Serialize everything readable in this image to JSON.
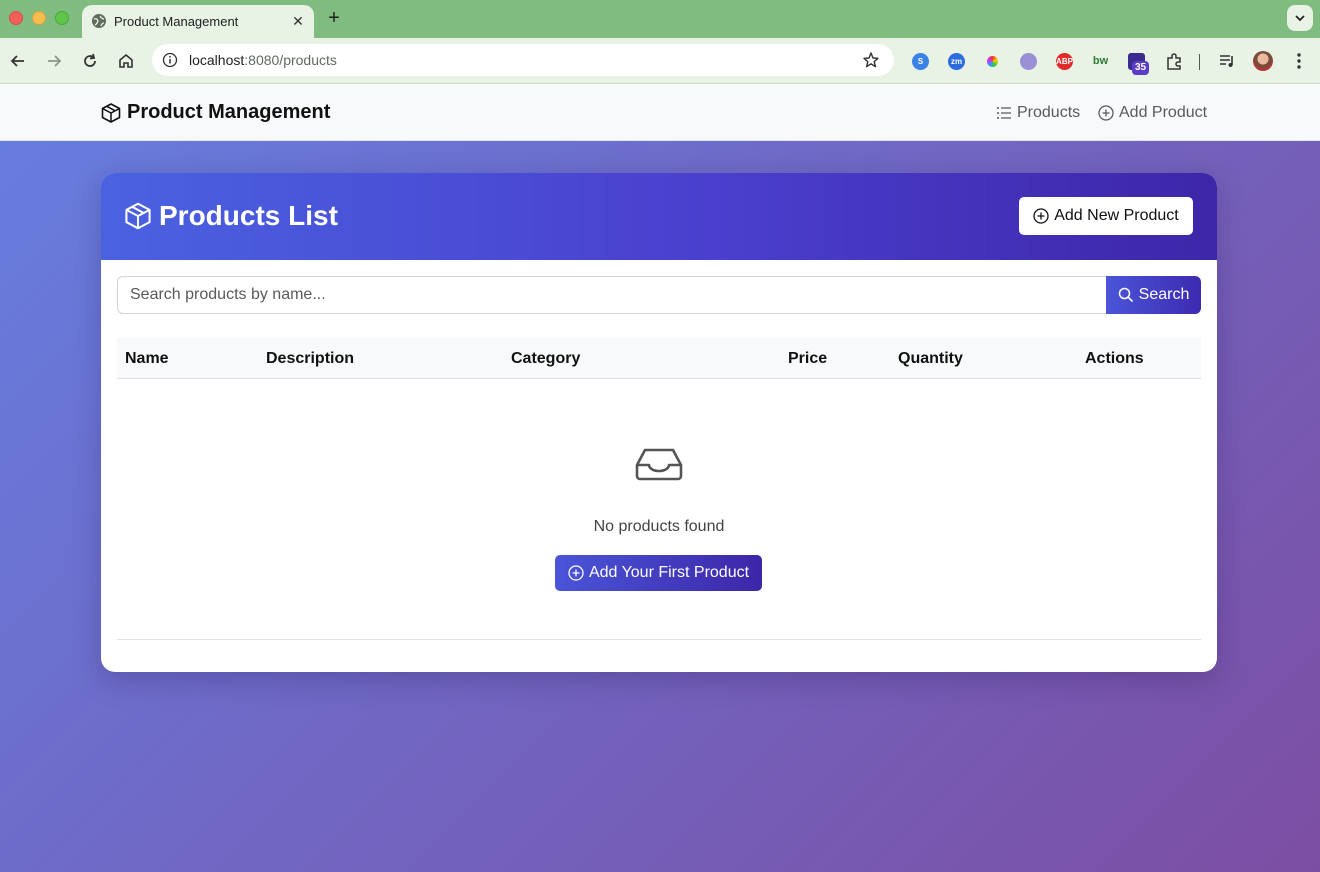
{
  "browser": {
    "tab_title": "Product Management",
    "tab_close": "✕",
    "new_tab": "+",
    "url_host": "localhost",
    "url_rest": ":8080/products",
    "extension_badge": "35"
  },
  "app": {
    "brand": "Product Management",
    "nav": {
      "products": "Products",
      "add_product": "Add Product"
    }
  },
  "card": {
    "title": "Products List",
    "add_new_button": "Add New Product",
    "search": {
      "placeholder": "Search products by name...",
      "button": "Search"
    },
    "table": {
      "columns": [
        "Name",
        "Description",
        "Category",
        "Price",
        "Quantity",
        "Actions"
      ]
    },
    "empty": {
      "message": "No products found",
      "button": "Add Your First Product"
    }
  },
  "colors": {
    "accent": "#4a3fce",
    "tabstrip": "#80bb80"
  }
}
